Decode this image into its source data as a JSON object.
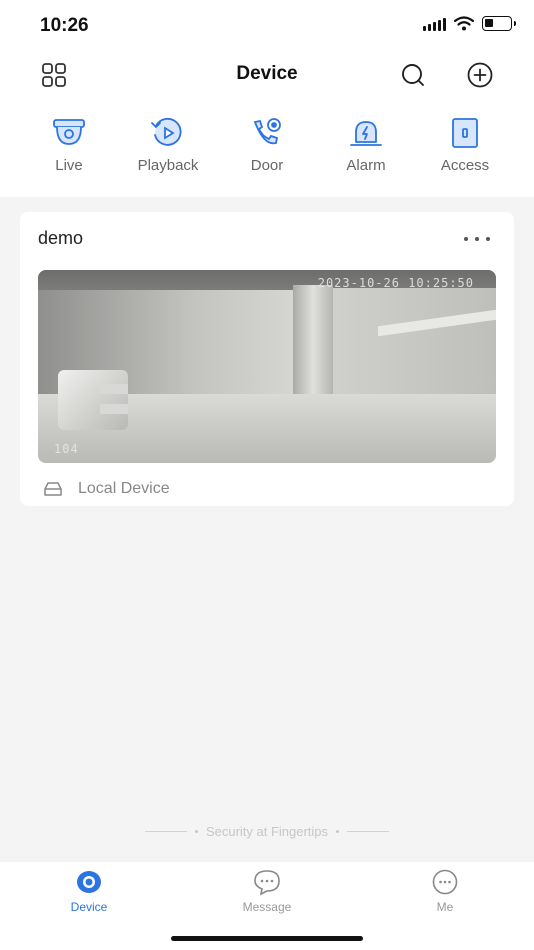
{
  "status_bar": {
    "time": "10:26"
  },
  "header": {
    "title": "Device",
    "left_icon": "grid-icon",
    "right_icons": [
      "search-icon",
      "add-circle-icon"
    ]
  },
  "shortcuts": [
    {
      "label": "Live",
      "icon": "dome-camera-icon"
    },
    {
      "label": "Playback",
      "icon": "playback-icon"
    },
    {
      "label": "Door",
      "icon": "door-call-icon"
    },
    {
      "label": "Alarm",
      "icon": "alarm-siren-icon"
    },
    {
      "label": "Access",
      "icon": "access-door-icon"
    }
  ],
  "device_card": {
    "name": "demo",
    "preview": {
      "timestamp": "2023-10-26 10:25:50",
      "channel": "104"
    },
    "source": "Local Device"
  },
  "footer": {
    "slogan": "Security at Fingertips"
  },
  "tabbar": [
    {
      "label": "Device",
      "icon": "device-tab-icon",
      "active": true
    },
    {
      "label": "Message",
      "icon": "message-tab-icon",
      "active": false
    },
    {
      "label": "Me",
      "icon": "me-tab-icon",
      "active": false
    }
  ],
  "colors": {
    "accent": "#2b74e2",
    "accent_light": "#d8e6fb",
    "background": "#f4f4f4"
  }
}
